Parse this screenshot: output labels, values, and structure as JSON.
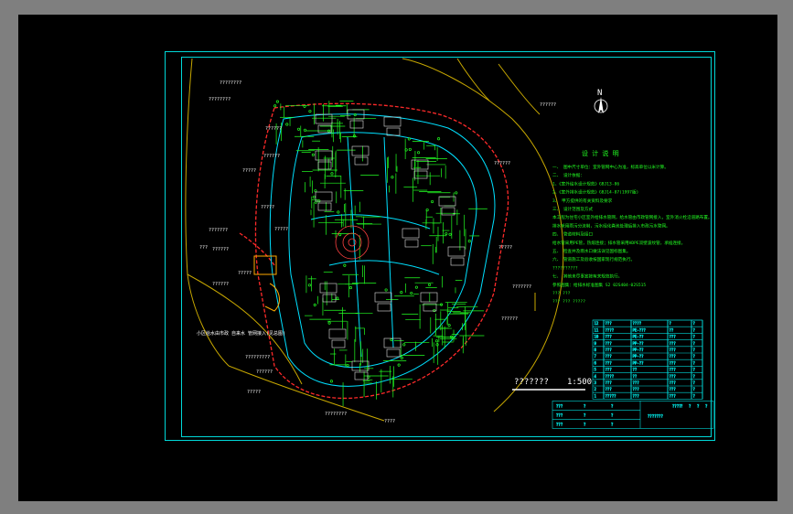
{
  "drawing": {
    "north_label": "N",
    "scale_prefix": "???????",
    "scale_ratio": "1:500",
    "notes_title": "设 计 说 明",
    "notes": [
      "一、 图中尺寸单位：室外管网中心为准，标高单位以米计算。",
      "二、 设计依据：",
      "1、《室外给水设计规范》GBJ13-86",
      "2、《室外排水设计规范》GBJ14-87(1997版)",
      "3、 甲方提供的有关资料及要求",
      "三、 设计范围及方式",
      "本工程为住宅小区室外给排水管网，给水管由市政管网接入，室外消火栓沿道路布置。",
      "排水采用雨污分流制，污水经化粪池处理后排入市政污水管网。",
      "四、 管道材料及接口",
      "给水管采用PE管，热熔连接；排水管采用HDPE双壁波纹管，承插连接。",
      "五、 检查井及雨水口做法详见国标图集。",
      "六、 管道施工及验收按国家现行规范执行。",
      "??????????",
      "七、 其他未尽事宜按有关规范执行。",
      "参照图集：给排水标准图集 S2 02S404-02S515",
      "??? ???",
      "??? ??? ?????"
    ],
    "site_labels": [
      "????????",
      "????????",
      "??????",
      "?????",
      "?????",
      "???????",
      "?????",
      "??????",
      "?????",
      "??????",
      "???",
      "??????",
      "?????????",
      "??????",
      "?????",
      "????????",
      "????",
      "??????",
      "?????",
      "???????",
      "??????",
      "??????"
    ],
    "callout": "小区给水由市政 自来水 管网接入(见总图)",
    "title_block": {
      "project": "???????",
      "rows": [
        [
          "12",
          "???",
          "????",
          "?",
          "?"
        ],
        [
          "11",
          "????",
          "PE-???",
          "??",
          "?"
        ],
        [
          "10",
          "???",
          "PE-??",
          "???",
          "?"
        ],
        [
          "9",
          "???",
          "PP-??",
          "???",
          "?"
        ],
        [
          "8",
          "???",
          "PP-??",
          "???",
          "?"
        ],
        [
          "7",
          "???",
          "PP-??",
          "???",
          "?"
        ],
        [
          "6",
          "???",
          "PP-??",
          "???",
          "?"
        ],
        [
          "5",
          "???",
          "??",
          "???",
          "?"
        ],
        [
          "4",
          "????",
          "??",
          "???",
          "?"
        ],
        [
          "3",
          "???",
          "???",
          "???",
          "?"
        ],
        [
          "2",
          "???",
          "???",
          "???",
          "?"
        ],
        [
          "1",
          "?????",
          "???",
          "???",
          "?"
        ]
      ],
      "footer_cells": [
        "????",
        "?",
        "?",
        "?",
        "?"
      ],
      "sign_rows": [
        [
          "???",
          "?",
          "?"
        ],
        [
          "???",
          "?",
          "?"
        ],
        [
          "???",
          "?",
          "?"
        ]
      ]
    }
  },
  "colors": {
    "background": "#000000",
    "border": "#00d8d8",
    "pipe_green": "#22ff22",
    "pipe_cyan": "#00e0ff",
    "pipe_red": "#ff2a2a",
    "road_yellow": "#d4b000",
    "text_white": "#ffffff"
  }
}
